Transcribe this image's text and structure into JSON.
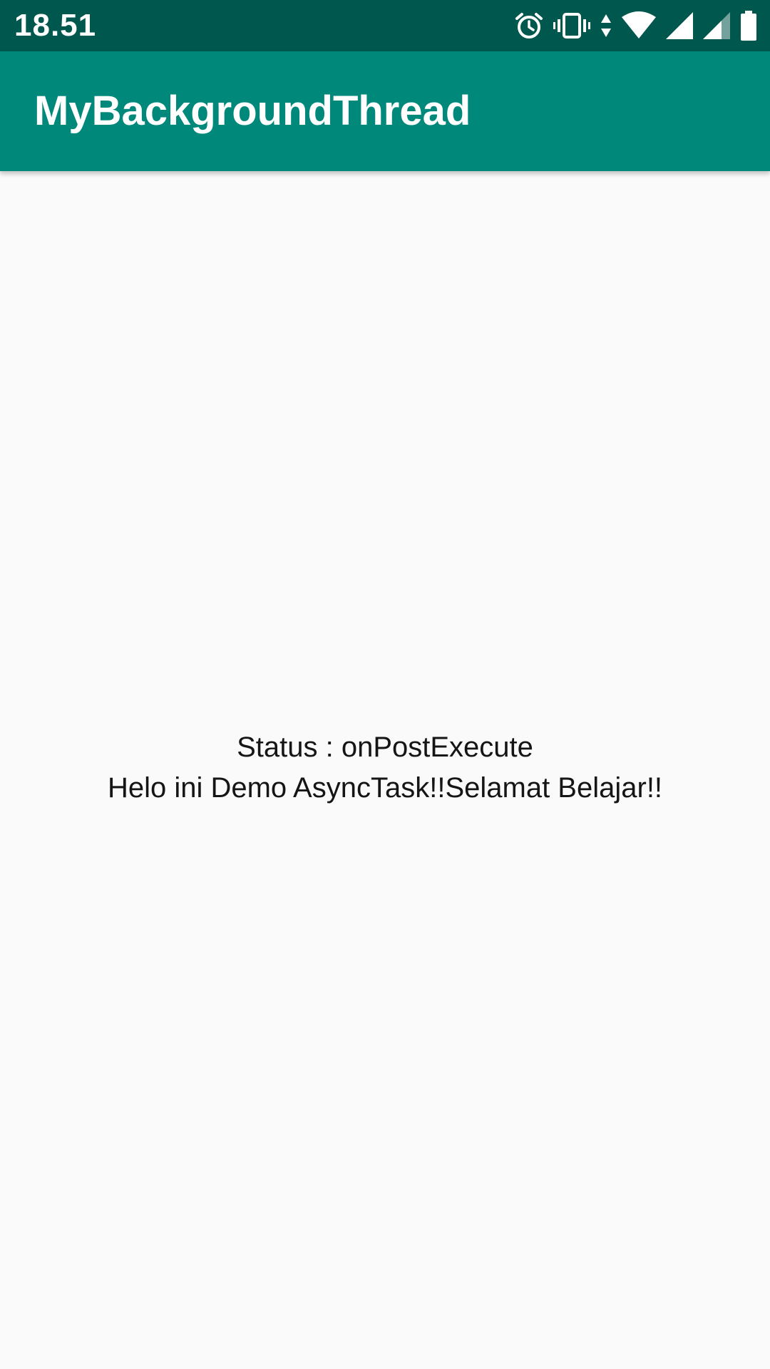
{
  "status_bar": {
    "time": "18.51",
    "icons": [
      "alarm-icon",
      "vibrate-icon",
      "data-activity-icon",
      "wifi-icon",
      "signal-icon",
      "signal-icon-2",
      "battery-icon"
    ],
    "background": "#00574d"
  },
  "app_bar": {
    "title": "MyBackgroundThread",
    "background": "#00897b"
  },
  "main": {
    "status_line": "Status : onPostExecute",
    "message_line": "Helo ini Demo AsyncTask!!Selamat Belajar!!",
    "background": "#fafafa"
  }
}
